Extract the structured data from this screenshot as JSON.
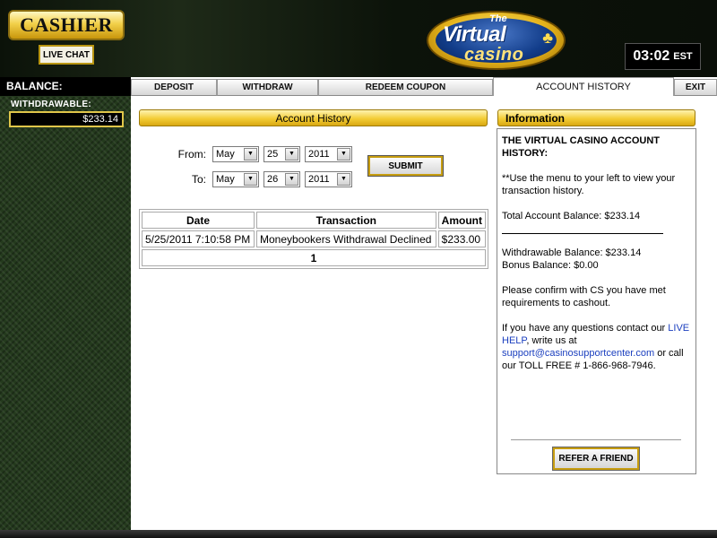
{
  "header": {
    "cashier_label": "CASHIER",
    "live_chat_label": "LIVE CHAT",
    "logo": {
      "the": "The",
      "virtual": "Virtual",
      "casino": "casino",
      "symbol": "♣"
    },
    "clock": {
      "time": "03:02",
      "zone": "EST"
    }
  },
  "balance": {
    "label": "BALANCE:",
    "withdrawable_label": "WITHDRAWABLE:",
    "withdrawable_value": "$233.14"
  },
  "tabs": [
    {
      "label": "DEPOSIT"
    },
    {
      "label": "WITHDRAW"
    },
    {
      "label": "REDEEM COUPON"
    },
    {
      "label": "ACCOUNT HISTORY",
      "active": true
    },
    {
      "label": "EXIT"
    }
  ],
  "account_history": {
    "title": "Account History",
    "from": {
      "label": "From:",
      "month": "May",
      "day": "25",
      "year": "2011"
    },
    "to": {
      "label": "To:",
      "month": "May",
      "day": "26",
      "year": "2011"
    },
    "submit_label": "SUBMIT",
    "table": {
      "headers": [
        "Date",
        "Transaction",
        "Amount"
      ],
      "rows": [
        [
          "5/25/2011 7:10:58 PM",
          "Moneybookers Withdrawal Declined",
          "$233.00"
        ]
      ],
      "page": "1"
    }
  },
  "info": {
    "title_header": "Information",
    "heading": "THE VIRTUAL CASINO ACCOUNT HISTORY:",
    "instructions": "**Use the menu to your left to view your transaction history.",
    "total_balance": "Total Account Balance: $233.14",
    "withdrawable_balance": "Withdrawable Balance: $233.14",
    "bonus_balance": "Bonus Balance: $0.00",
    "confirm_text": "Please confirm with CS you have met requirements to cashout.",
    "contact_prefix": "If you have any questions contact our ",
    "live_help": "LIVE HELP",
    "write_us": ", write us at ",
    "email": "support@casinosupportcenter.com",
    "call_text": " or call our TOLL FREE # 1-866-968-7946.",
    "refer_label": "REFER A FRIEND"
  },
  "colors": {
    "gold": "#f3cd35",
    "sidebar_green": "#243a1d",
    "link_blue": "#1b3fbf"
  }
}
